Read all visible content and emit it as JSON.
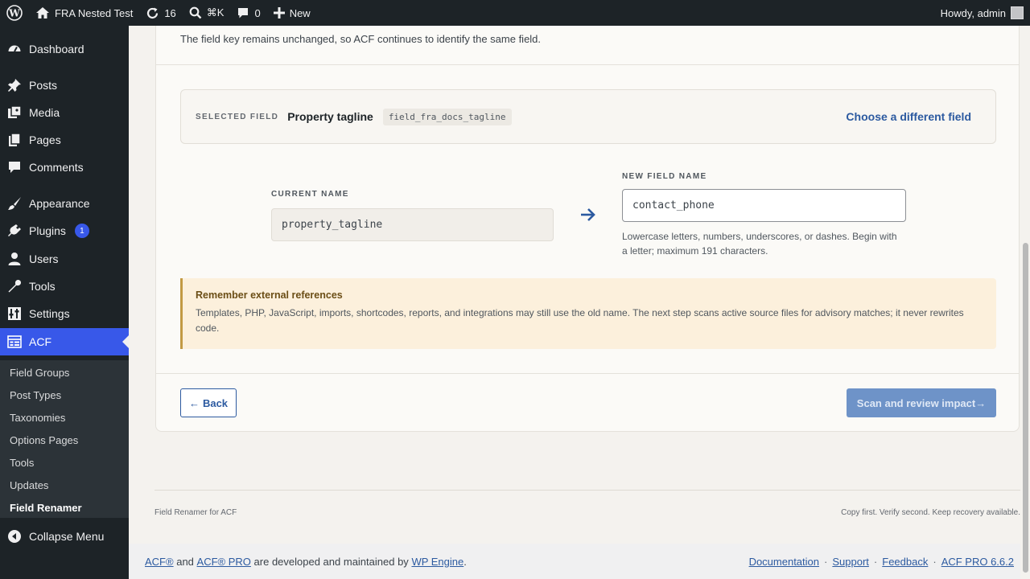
{
  "adminbar": {
    "site_name": "FRA Nested Test",
    "updates_count": "16",
    "shortcut": "⌘K",
    "comments_count": "0",
    "new_label": "New",
    "greeting": "Howdy, admin"
  },
  "sidebar": {
    "items": [
      {
        "label": "Dashboard",
        "icon": "dashboard-icon"
      },
      {
        "label": "Posts",
        "icon": "pin-icon"
      },
      {
        "label": "Media",
        "icon": "media-icon"
      },
      {
        "label": "Pages",
        "icon": "pages-icon"
      },
      {
        "label": "Comments",
        "icon": "comment-icon"
      },
      {
        "label": "Appearance",
        "icon": "brush-icon"
      },
      {
        "label": "Plugins",
        "icon": "plug-icon",
        "badge": "1"
      },
      {
        "label": "Users",
        "icon": "user-icon"
      },
      {
        "label": "Tools",
        "icon": "wrench-icon"
      },
      {
        "label": "Settings",
        "icon": "settings-icon"
      },
      {
        "label": "ACF",
        "icon": "acf-icon"
      }
    ],
    "submenu": [
      "Field Groups",
      "Post Types",
      "Taxonomies",
      "Options Pages",
      "Tools",
      "Updates",
      "Field Renamer"
    ],
    "collapse_label": "Collapse Menu"
  },
  "main": {
    "top_note": "The field key remains unchanged, so ACF continues to identify the same field.",
    "selected": {
      "label": "SELECTED FIELD",
      "name": "Property tagline",
      "key": "field_fra_docs_tagline",
      "choose_label": "Choose a different field"
    },
    "current": {
      "label": "CURRENT NAME",
      "value": "property_tagline"
    },
    "new_field": {
      "label": "NEW FIELD NAME",
      "value": "contact_phone",
      "hint": "Lowercase letters, numbers, underscores, or dashes. Begin with a letter; maximum 191 characters."
    },
    "notice": {
      "title": "Remember external references",
      "body": "Templates, PHP, JavaScript, imports, shortcodes, reports, and integrations may still use the old name. The next step scans active source files for advisory matches; it never rewrites code."
    },
    "back_label": "Back",
    "scan_label": "Scan and review impact→"
  },
  "plugin_footer": {
    "left": "Field Renamer for ACF",
    "right": "Copy first. Verify second. Keep recovery available."
  },
  "acf_footer": {
    "acf": "ACF®",
    "and": "and",
    "acf_pro": "ACF® PRO",
    "developed": "are developed and maintained by",
    "wp_engine": "WP Engine",
    "period": ".",
    "links": [
      "Documentation",
      "Support",
      "Feedback",
      "ACF PRO 6.6.2"
    ]
  },
  "colors": {
    "accent": "#3858e9",
    "link": "#2c5aa0",
    "adminbar": "#1d2327",
    "notice_bg": "#fcf0dc"
  }
}
